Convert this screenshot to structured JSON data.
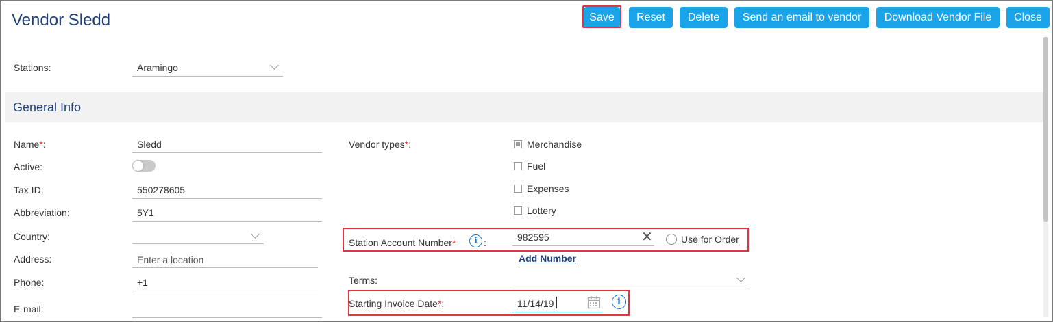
{
  "title": "Vendor Sledd",
  "buttons": {
    "save": "Save",
    "reset": "Reset",
    "delete": "Delete",
    "email": "Send an email to vendor",
    "download": "Download Vendor File",
    "close": "Close"
  },
  "stations": {
    "label": "Stations:",
    "value": "Aramingo"
  },
  "section_title": "General Info",
  "left": {
    "name_label": "Name",
    "name_value": "Sledd",
    "active_label": "Active:",
    "active_on": false,
    "taxid_label": "Tax ID:",
    "taxid_value": "550278605",
    "abbr_label": "Abbreviation:",
    "abbr_value": "5Y1",
    "country_label": "Country:",
    "address_label": "Address:",
    "address_placeholder": "Enter a location",
    "phone_label": "Phone:",
    "phone_value": "+1",
    "email_label": "E-mail:"
  },
  "right": {
    "vendor_types_label": "Vendor types",
    "vendor_types": [
      {
        "label": "Merchandise",
        "checked": true
      },
      {
        "label": "Fuel",
        "checked": false
      },
      {
        "label": "Expenses",
        "checked": false
      },
      {
        "label": "Lottery",
        "checked": false
      }
    ],
    "station_account_label": "Station Account Number",
    "station_account_value": "982595",
    "use_for_order": "Use for Order",
    "add_number": "Add Number",
    "terms_label": "Terms:",
    "starting_invoice_label": "Starting Invoice Date",
    "starting_invoice_value": "11/14/19"
  },
  "colors": {
    "accent": "#1aa3e8",
    "title": "#1f3f7a",
    "required": "#e0363f",
    "highlight": "#e0363f",
    "info": "#1a73c9"
  },
  "icons": {
    "clear": "close-x-icon",
    "calendar": "calendar-icon",
    "info": "info-icon",
    "dropdown": "chevron-down-icon"
  }
}
